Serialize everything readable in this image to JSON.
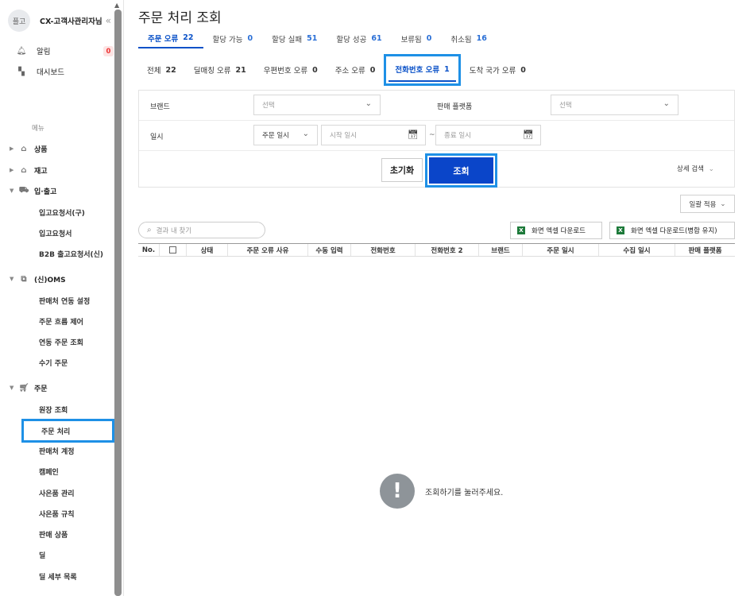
{
  "sidebar": {
    "avatar": "플고",
    "company": "CX-고객사관리자님",
    "collapse": "«",
    "top_items": [
      {
        "label": "알림",
        "icon": "bell-icon",
        "badge": "0"
      },
      {
        "label": "대시보드",
        "icon": "dashboard-icon"
      }
    ],
    "menu_caption": "메뉴",
    "groups": [
      {
        "label": "상품",
        "icon": "box-icon",
        "expanded": false
      },
      {
        "label": "재고",
        "icon": "warehouse-icon",
        "expanded": false
      },
      {
        "label": "입·출고",
        "icon": "truck-icon",
        "expanded": true,
        "children": [
          "입고요청서(구)",
          "입고요청서",
          "B2B 출고요청서(신)"
        ]
      },
      {
        "label": "(신)OMS",
        "icon": "oms-icon",
        "expanded": true,
        "children": [
          "판매처 연동 설정",
          "주문 흐름 제어",
          "연동 주문 조회",
          "수기 주문"
        ]
      },
      {
        "label": "주문",
        "icon": "cart-icon",
        "expanded": true,
        "children": [
          "원장 조회",
          "주문 처리",
          "판매처 계정",
          "캠페인",
          "사은품 관리",
          "사은품 규칙",
          "판매 상품",
          "딜",
          "딜 세부 목록"
        ]
      }
    ],
    "active_item": "주문 처리"
  },
  "main": {
    "title": "주문 처리 조회",
    "tabs": [
      {
        "label": "주문 오류",
        "count": "22"
      },
      {
        "label": "할당 가능",
        "count": "0"
      },
      {
        "label": "할당 실패",
        "count": "51"
      },
      {
        "label": "할당 성공",
        "count": "61"
      },
      {
        "label": "보류됨",
        "count": "0"
      },
      {
        "label": "취소됨",
        "count": "16"
      }
    ],
    "subtabs": [
      {
        "label": "전체",
        "count": "22"
      },
      {
        "label": "딜매칭 오류",
        "count": "21"
      },
      {
        "label": "우편번호 오류",
        "count": "0"
      },
      {
        "label": "주소 오류",
        "count": "0"
      },
      {
        "label": "전화번호 오류",
        "count": "1"
      },
      {
        "label": "도착 국가 오류",
        "count": "0"
      }
    ],
    "filter": {
      "brand_label": "브랜드",
      "brand_placeholder": "선택",
      "platform_label": "판매 플랫폼",
      "platform_placeholder": "선택",
      "date_label": "일시",
      "date_type": "주문 일시",
      "start_placeholder": "시작 일시",
      "end_placeholder": "종료 일시",
      "tilde": "~",
      "reset": "초기화",
      "search": "조회",
      "advanced": "상세 검색"
    },
    "bulk_apply": "일괄 적용",
    "search_placeholder": "결과 내 찾기",
    "excel_download": "화면 엑셀 다운로드",
    "excel_download_merged": "화면 엑셀 다운로드(병합 유지)",
    "columns": [
      "No.",
      "",
      "상태",
      "주문 오류 사유",
      "수동 입력",
      "전화번호",
      "전화번호 2",
      "브랜드",
      "주문 일시",
      "수집 일시",
      "판매 플랫폼"
    ],
    "empty_message": "조회하기를 눌러주세요."
  }
}
